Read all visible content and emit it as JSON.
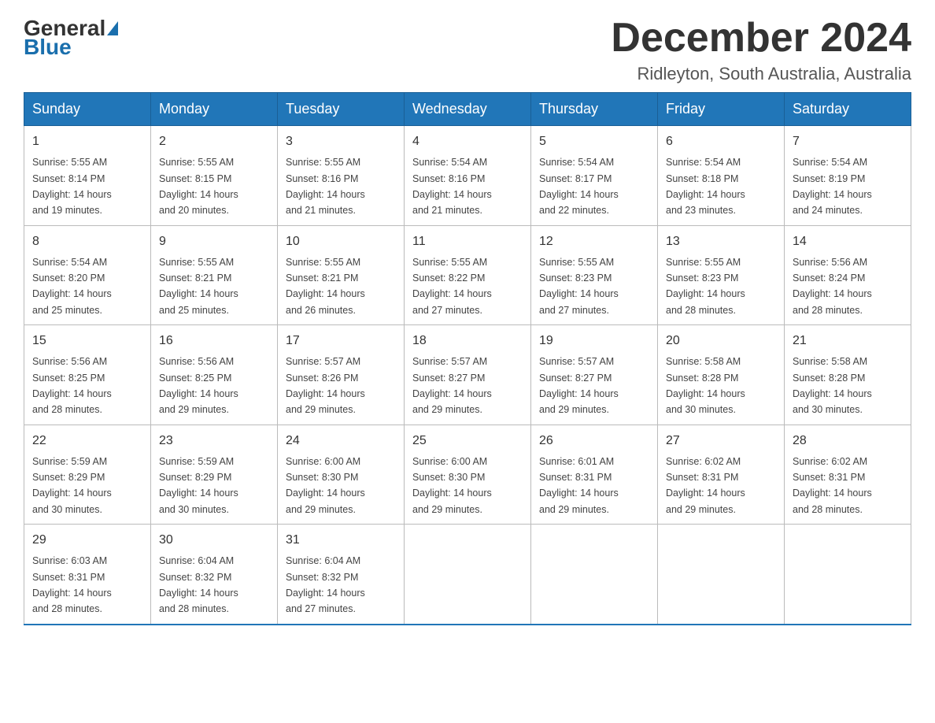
{
  "header": {
    "logo_general": "General",
    "logo_blue": "Blue",
    "title": "December 2024",
    "subtitle": "Ridleyton, South Australia, Australia"
  },
  "weekdays": [
    "Sunday",
    "Monday",
    "Tuesday",
    "Wednesday",
    "Thursday",
    "Friday",
    "Saturday"
  ],
  "weeks": [
    [
      {
        "day": "1",
        "sunrise": "5:55 AM",
        "sunset": "8:14 PM",
        "daylight": "14 hours and 19 minutes."
      },
      {
        "day": "2",
        "sunrise": "5:55 AM",
        "sunset": "8:15 PM",
        "daylight": "14 hours and 20 minutes."
      },
      {
        "day": "3",
        "sunrise": "5:55 AM",
        "sunset": "8:16 PM",
        "daylight": "14 hours and 21 minutes."
      },
      {
        "day": "4",
        "sunrise": "5:54 AM",
        "sunset": "8:16 PM",
        "daylight": "14 hours and 21 minutes."
      },
      {
        "day": "5",
        "sunrise": "5:54 AM",
        "sunset": "8:17 PM",
        "daylight": "14 hours and 22 minutes."
      },
      {
        "day": "6",
        "sunrise": "5:54 AM",
        "sunset": "8:18 PM",
        "daylight": "14 hours and 23 minutes."
      },
      {
        "day": "7",
        "sunrise": "5:54 AM",
        "sunset": "8:19 PM",
        "daylight": "14 hours and 24 minutes."
      }
    ],
    [
      {
        "day": "8",
        "sunrise": "5:54 AM",
        "sunset": "8:20 PM",
        "daylight": "14 hours and 25 minutes."
      },
      {
        "day": "9",
        "sunrise": "5:55 AM",
        "sunset": "8:21 PM",
        "daylight": "14 hours and 25 minutes."
      },
      {
        "day": "10",
        "sunrise": "5:55 AM",
        "sunset": "8:21 PM",
        "daylight": "14 hours and 26 minutes."
      },
      {
        "day": "11",
        "sunrise": "5:55 AM",
        "sunset": "8:22 PM",
        "daylight": "14 hours and 27 minutes."
      },
      {
        "day": "12",
        "sunrise": "5:55 AM",
        "sunset": "8:23 PM",
        "daylight": "14 hours and 27 minutes."
      },
      {
        "day": "13",
        "sunrise": "5:55 AM",
        "sunset": "8:23 PM",
        "daylight": "14 hours and 28 minutes."
      },
      {
        "day": "14",
        "sunrise": "5:56 AM",
        "sunset": "8:24 PM",
        "daylight": "14 hours and 28 minutes."
      }
    ],
    [
      {
        "day": "15",
        "sunrise": "5:56 AM",
        "sunset": "8:25 PM",
        "daylight": "14 hours and 28 minutes."
      },
      {
        "day": "16",
        "sunrise": "5:56 AM",
        "sunset": "8:25 PM",
        "daylight": "14 hours and 29 minutes."
      },
      {
        "day": "17",
        "sunrise": "5:57 AM",
        "sunset": "8:26 PM",
        "daylight": "14 hours and 29 minutes."
      },
      {
        "day": "18",
        "sunrise": "5:57 AM",
        "sunset": "8:27 PM",
        "daylight": "14 hours and 29 minutes."
      },
      {
        "day": "19",
        "sunrise": "5:57 AM",
        "sunset": "8:27 PM",
        "daylight": "14 hours and 29 minutes."
      },
      {
        "day": "20",
        "sunrise": "5:58 AM",
        "sunset": "8:28 PM",
        "daylight": "14 hours and 30 minutes."
      },
      {
        "day": "21",
        "sunrise": "5:58 AM",
        "sunset": "8:28 PM",
        "daylight": "14 hours and 30 minutes."
      }
    ],
    [
      {
        "day": "22",
        "sunrise": "5:59 AM",
        "sunset": "8:29 PM",
        "daylight": "14 hours and 30 minutes."
      },
      {
        "day": "23",
        "sunrise": "5:59 AM",
        "sunset": "8:29 PM",
        "daylight": "14 hours and 30 minutes."
      },
      {
        "day": "24",
        "sunrise": "6:00 AM",
        "sunset": "8:30 PM",
        "daylight": "14 hours and 29 minutes."
      },
      {
        "day": "25",
        "sunrise": "6:00 AM",
        "sunset": "8:30 PM",
        "daylight": "14 hours and 29 minutes."
      },
      {
        "day": "26",
        "sunrise": "6:01 AM",
        "sunset": "8:31 PM",
        "daylight": "14 hours and 29 minutes."
      },
      {
        "day": "27",
        "sunrise": "6:02 AM",
        "sunset": "8:31 PM",
        "daylight": "14 hours and 29 minutes."
      },
      {
        "day": "28",
        "sunrise": "6:02 AM",
        "sunset": "8:31 PM",
        "daylight": "14 hours and 28 minutes."
      }
    ],
    [
      {
        "day": "29",
        "sunrise": "6:03 AM",
        "sunset": "8:31 PM",
        "daylight": "14 hours and 28 minutes."
      },
      {
        "day": "30",
        "sunrise": "6:04 AM",
        "sunset": "8:32 PM",
        "daylight": "14 hours and 28 minutes."
      },
      {
        "day": "31",
        "sunrise": "6:04 AM",
        "sunset": "8:32 PM",
        "daylight": "14 hours and 27 minutes."
      },
      null,
      null,
      null,
      null
    ]
  ],
  "labels": {
    "sunrise": "Sunrise:",
    "sunset": "Sunset:",
    "daylight": "Daylight:"
  }
}
